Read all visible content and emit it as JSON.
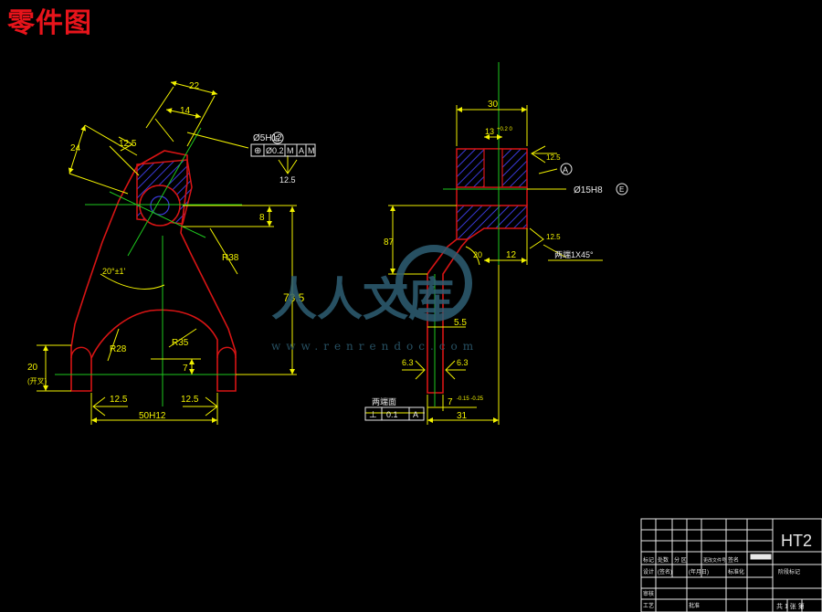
{
  "title": "零件图",
  "watermark": {
    "text": "人人文库",
    "url": "www.renrendoc.com"
  },
  "left_view": {
    "dims": {
      "d22": "22",
      "d14": "14",
      "d24": "24",
      "r125": "12.5",
      "angle": "20°±1'",
      "r38": "R38",
      "d8": "8",
      "d735": "73.5",
      "r28": "R28",
      "r35": "R35",
      "d7": "7",
      "d20": "20",
      "d20_note": "(开叉)",
      "f1": "12.5",
      "f2": "12.5",
      "d50": "50H12"
    },
    "fcf": {
      "hole": "Ø5H12",
      "envelope": "E",
      "symbol": "⊕",
      "tol": "Ø0.2",
      "m1": "M",
      "ref": "A",
      "m2": "M",
      "rough": "12.5"
    }
  },
  "right_view": {
    "dims": {
      "d30": "30",
      "d13": "13",
      "d13_tol": "+0.2\n0",
      "d87": "87",
      "d55": "5.5",
      "d20r": "20",
      "d12": "12",
      "d63l": "6.3",
      "d63r": "6.3",
      "d7": "7",
      "d7_tol": "-0.15\n-0.25",
      "d31": "31",
      "r125a": "12.5",
      "r125b": "12.5"
    },
    "datum": "A",
    "hole": "Ø15H8",
    "envelope": "E",
    "chamfer": "两端1X45°",
    "ends": "两端面",
    "perp": {
      "symbol": "⊥",
      "tol": "0.1",
      "ref": "A"
    }
  },
  "title_block": {
    "material": "HT2",
    "row1": [
      "标记",
      "处数",
      "分 区",
      "更改文件号",
      "签名"
    ],
    "row2": [
      "设计",
      "(签名)",
      "(年月日)",
      "标准化"
    ],
    "row3": [
      "审核"
    ],
    "row4": [
      "工艺",
      "批准"
    ],
    "stage": "阶段标记",
    "sheet": "共 1 张   第"
  }
}
